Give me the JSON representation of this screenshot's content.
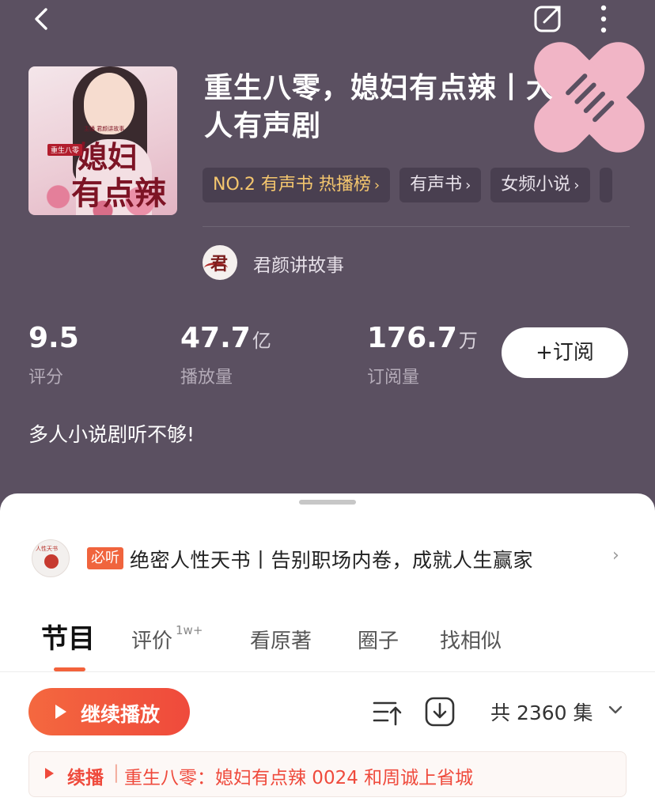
{
  "header": {
    "back_icon": "chevron-left-icon",
    "share_icon": "share-icon",
    "more_icon": "more-vertical-icon"
  },
  "album": {
    "cover": {
      "tag": "重生八零",
      "title_line1": "媳妇",
      "title_line2": "有点辣",
      "side_text": "主播 君颜讲故事"
    },
    "title": "重生八零，媳妇有点辣丨大热多人有声剧",
    "chips": [
      {
        "label": "NO.2 有声书 热播榜",
        "arrow": "›"
      },
      {
        "label": "有声书",
        "arrow": "›"
      },
      {
        "label": "女频小说",
        "arrow": "›"
      }
    ],
    "author": {
      "avatar_mark": "君颜",
      "name": "君颜讲故事"
    },
    "stats": [
      {
        "value": "9.5",
        "unit": "",
        "label": "评分"
      },
      {
        "value": "47.7",
        "unit": "亿",
        "label": "播放量"
      },
      {
        "value": "176.7",
        "unit": "万",
        "label": "订阅量"
      }
    ],
    "subscribe_label": "+订阅",
    "intro": "多人小说剧听不够!"
  },
  "promo": {
    "icon_text": "人性天书",
    "badge": "必听",
    "text": "绝密人性天书丨告别职场内卷，成就人生赢家",
    "arrow": "›"
  },
  "tabs": [
    {
      "label": "节目",
      "sup": ""
    },
    {
      "label": "评价",
      "sup": "1w+"
    },
    {
      "label": "看原著",
      "sup": ""
    },
    {
      "label": "圈子",
      "sup": ""
    },
    {
      "label": "找相似",
      "sup": ""
    }
  ],
  "toolbar": {
    "play_label": "继续播放",
    "sort_icon": "sort-icon",
    "download_icon": "download-icon",
    "episode_count": "共 2360 集"
  },
  "resume": {
    "keyword": "续播",
    "separator": "|",
    "episode": "重生八零：媳妇有点辣 0024 和周诚上省城"
  },
  "colors": {
    "header_bg": "#5b5061",
    "accent": "#ef4a3c",
    "rank_chip_text": "#f4c66e",
    "sticker": "#f1b5c6"
  }
}
